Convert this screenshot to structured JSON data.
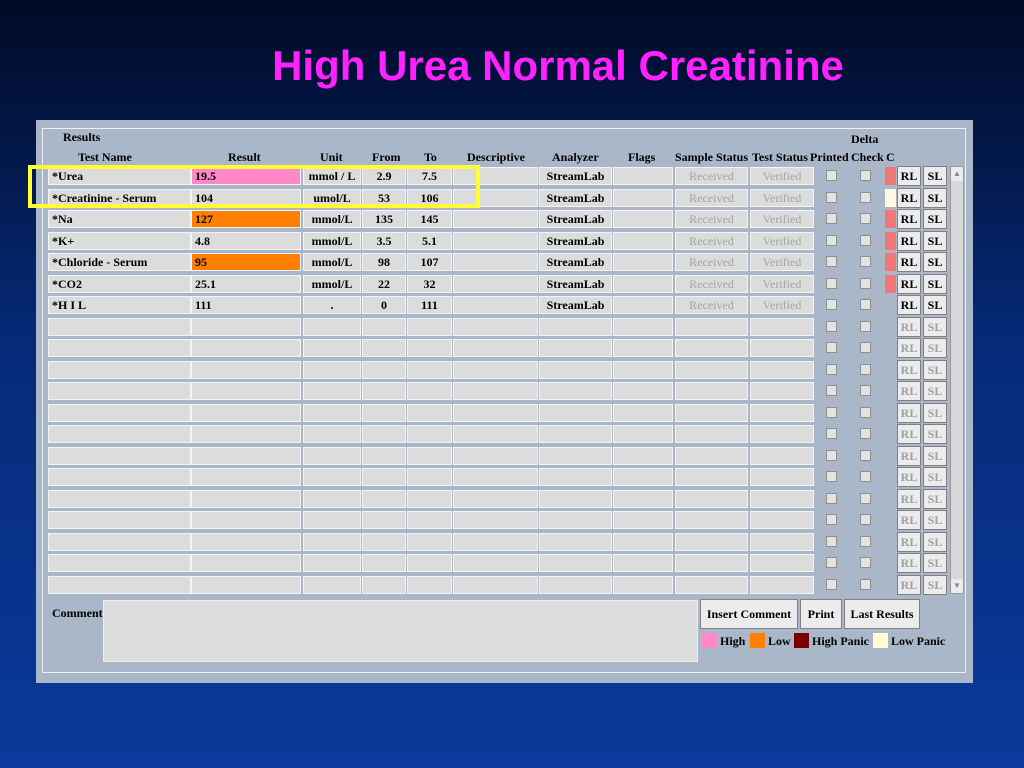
{
  "slide_title": "High Urea Normal Creatinine",
  "group_label": "Results",
  "headers": {
    "test_name": "Test Name",
    "result": "Result",
    "unit": "Unit",
    "from": "From",
    "to": "To",
    "descriptive": "Descriptive",
    "analyzer": "Analyzer",
    "flags": "Flags",
    "sample_status": "Sample Status",
    "test_status": "Test Status",
    "printed": "Printed",
    "delta": "Delta",
    "check": "Check",
    "c": "C"
  },
  "rows": [
    {
      "test": "*Urea",
      "result": "19.5",
      "result_flag": "high",
      "unit": "mmol / L",
      "from": "2.9",
      "to": "7.5",
      "analyzer": "StreamLab",
      "sample_status": "Received",
      "test_status": "Verified",
      "c_flag": "#f07878",
      "rl": "RL",
      "sl": "SL"
    },
    {
      "test": "*Creatinine - Serum",
      "result": "104",
      "result_flag": "",
      "unit": "umol/L",
      "from": "53",
      "to": "106",
      "analyzer": "StreamLab",
      "sample_status": "Received",
      "test_status": "Verified",
      "c_flag": "#fffbe0",
      "rl": "RL",
      "sl": "SL"
    },
    {
      "test": "*Na",
      "result": "127",
      "result_flag": "low",
      "unit": "mmol/L",
      "from": "135",
      "to": "145",
      "analyzer": "StreamLab",
      "sample_status": "Received",
      "test_status": "Verified",
      "c_flag": "#f07878",
      "rl": "RL",
      "sl": "SL"
    },
    {
      "test": "*K+",
      "result": "4.8",
      "result_flag": "",
      "unit": "mmol/L",
      "from": "3.5",
      "to": "5.1",
      "analyzer": "StreamLab",
      "sample_status": "Received",
      "test_status": "Verified",
      "c_flag": "#f07878",
      "rl": "RL",
      "sl": "SL"
    },
    {
      "test": "*Chloride - Serum",
      "result": "95",
      "result_flag": "low",
      "unit": "mmol/L",
      "from": "98",
      "to": "107",
      "analyzer": "StreamLab",
      "sample_status": "Received",
      "test_status": "Verified",
      "c_flag": "#f07878",
      "rl": "RL",
      "sl": "SL"
    },
    {
      "test": "*CO2",
      "result": "25.1",
      "result_flag": "",
      "unit": "mmol/L",
      "from": "22",
      "to": "32",
      "analyzer": "StreamLab",
      "sample_status": "Received",
      "test_status": "Verified",
      "c_flag": "#f07878",
      "rl": "RL",
      "sl": "SL"
    },
    {
      "test": "*H I L",
      "result": "111",
      "result_flag": "",
      "unit": ".",
      "from": "0",
      "to": "111",
      "analyzer": "StreamLab",
      "sample_status": "Received",
      "test_status": "Verified",
      "c_flag": "",
      "rl": "RL",
      "sl": "SL"
    }
  ],
  "empty_row_button_labels": {
    "rl": "RL",
    "sl": "SL"
  },
  "comment_label": "Comment",
  "buttons": {
    "insert_comment": "Insert Comment",
    "print": "Print",
    "last_results": "Last Results"
  },
  "legend": [
    {
      "label": "High",
      "color": "#ff88c8"
    },
    {
      "label": "Low",
      "color": "#ff7f00"
    },
    {
      "label": "High Panic",
      "color": "#7a0000"
    },
    {
      "label": "Low Panic",
      "color": "#fffbd6"
    }
  ],
  "colors": {
    "high": "#ff88c8",
    "low": "#ff7f00",
    "highlight": "#ffff33",
    "title": "#ff21ff"
  },
  "total_rows": 20
}
